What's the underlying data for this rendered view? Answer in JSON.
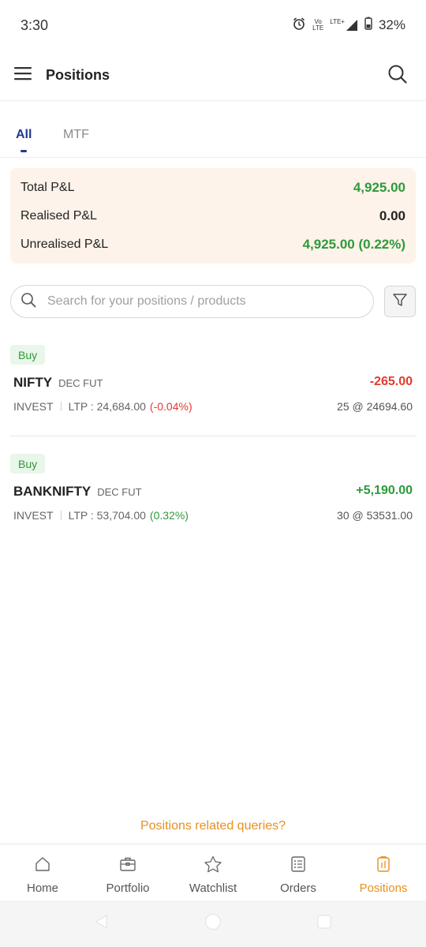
{
  "status": {
    "time": "3:30",
    "net_line1": "Vo",
    "net_line2": "LTE",
    "lte_label": "LTE+",
    "battery": "32%"
  },
  "header": {
    "title": "Positions"
  },
  "tabs": [
    {
      "label": "All",
      "active": true
    },
    {
      "label": "MTF",
      "active": false
    }
  ],
  "summary": {
    "total_label": "Total P&L",
    "total_value": "4,925.00",
    "realised_label": "Realised P&L",
    "realised_value": "0.00",
    "unrealised_label": "Unrealised P&L",
    "unrealised_value": "4,925.00 (0.22%)"
  },
  "search": {
    "placeholder": "Search for your positions / products"
  },
  "positions": [
    {
      "side": "Buy",
      "symbol": "NIFTY",
      "expiry": "DEC FUT",
      "pnl": "-265.00",
      "product": "INVEST",
      "ltp_label": "LTP : 24,684.00",
      "change": "(-0.04%)",
      "qty_price": "25 @ 24694.60"
    },
    {
      "side": "Buy",
      "symbol": "BANKNIFTY",
      "expiry": "DEC FUT",
      "pnl": "+5,190.00",
      "product": "INVEST",
      "ltp_label": "LTP : 53,704.00",
      "change": "(0.32%)",
      "qty_price": "30 @ 53531.00"
    }
  ],
  "queries_link": "Positions related queries?",
  "bottom_nav": [
    {
      "label": "Home",
      "icon": "home-icon"
    },
    {
      "label": "Portfolio",
      "icon": "briefcase-icon"
    },
    {
      "label": "Watchlist",
      "icon": "star-icon"
    },
    {
      "label": "Orders",
      "icon": "orders-icon"
    },
    {
      "label": "Positions",
      "icon": "positions-icon",
      "active": true
    }
  ],
  "colors": {
    "accent": "#e8901c",
    "tab_active": "#1f3a93",
    "profit": "#2e9a3a",
    "loss": "#e23b2e",
    "summary_bg": "#fdf3ea"
  }
}
